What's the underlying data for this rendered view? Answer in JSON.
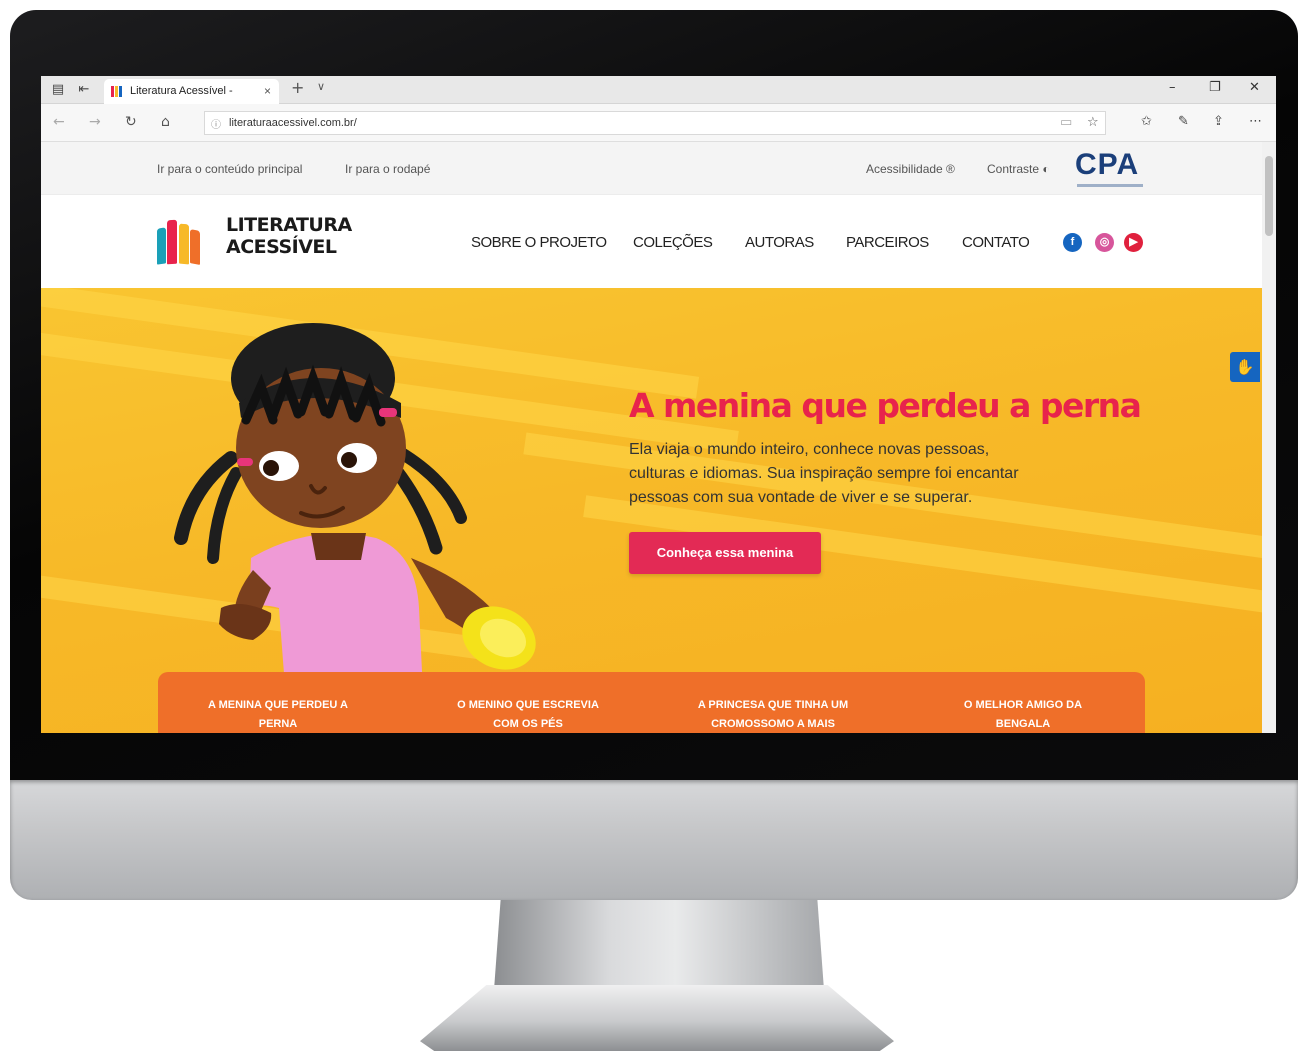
{
  "browser": {
    "tab_title": "Literatura Acessível -",
    "tab_close": "×",
    "new_tab": "+",
    "tab_list": "∨",
    "url": "literaturaacessivel.com.br/",
    "controls": {
      "minimize": "–",
      "restore": "❐",
      "close": "✕"
    }
  },
  "accessibility_bar": {
    "skip_main": "Ir para o conteúdo principal",
    "skip_footer": "Ir para o rodapé",
    "accessibility": "Acessibilidade ®",
    "contrast": "Contraste ◐",
    "partner_logo": "CPA"
  },
  "header": {
    "logo_line1": "LITERATURA",
    "logo_line2": "ACESSÍVEL",
    "nav": [
      "SOBRE O PROJETO",
      "COLEÇÕES",
      "AUTORAS",
      "PARCEIROS",
      "CONTATO"
    ],
    "social_icons": [
      "facebook-icon",
      "instagram-icon",
      "youtube-icon"
    ]
  },
  "hero": {
    "title": "A menina que perdeu a perna",
    "text_lines": [
      "Ela viaja o mundo inteiro, conhece novas pessoas,",
      "culturas e idiomas. Sua inspiração sempre foi encantar",
      "pessoas com sua vontade de viver e se superar."
    ],
    "button": "Conheça essa menina"
  },
  "book_tabs": [
    {
      "line1": "A MENINA QUE PERDEU A",
      "line2": "PERNA"
    },
    {
      "line1": "O MENINO QUE ESCREVIA",
      "line2": "COM OS PÉS"
    },
    {
      "line1": "A PRINCESA QUE TINHA UM",
      "line2": "CROMOSSOMO A MAIS"
    },
    {
      "line1": "O MELHOR AMIGO DA",
      "line2": "BENGALA"
    }
  ],
  "colors": {
    "hero_bg": "#f7b928",
    "title_red": "#e8234c",
    "button": "#e32a55",
    "book_bar": "#ef6f29",
    "facebook": "#1565c0",
    "instagram": "#d7559b",
    "youtube": "#e0203d"
  }
}
